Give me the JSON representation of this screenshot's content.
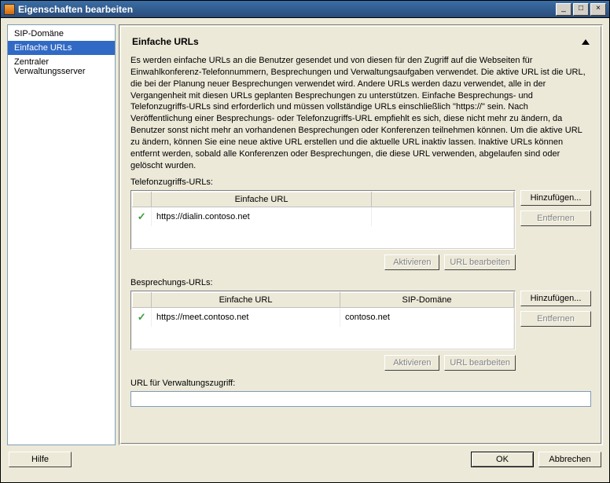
{
  "window": {
    "title": "Eigenschaften bearbeiten"
  },
  "sidebar": {
    "items": [
      {
        "label": "SIP-Domäne"
      },
      {
        "label": "Einfache URLs"
      },
      {
        "label": "Zentraler Verwaltungsserver"
      }
    ],
    "selectedIndex": 1
  },
  "panel": {
    "title": "Einfache URLs",
    "description": "Es werden einfache URLs an die Benutzer gesendet und von diesen für den Zugriff auf die Webseiten für Einwahlkonferenz-Telefonnummern, Besprechungen und Verwaltungsaufgaben verwendet. Die aktive URL ist die URL, die bei der Planung neuer Besprechungen verwendet wird. Andere URLs werden dazu verwendet, alle in der Vergangenheit mit diesen URLs geplanten Besprechungen zu unterstützen. Einfache Besprechungs- und Telefonzugriffs-URLs sind erforderlich und müssen vollständige URLs einschließlich \"https://\" sein. Nach Veröffentlichung einer Besprechungs- oder Telefonzugriffs-URL empfiehlt es sich, diese nicht mehr zu ändern, da Benutzer sonst nicht mehr an vorhandenen Besprechungen oder Konferenzen teilnehmen können. Um die aktive URL zu ändern, können Sie eine neue aktive URL erstellen und die aktuelle URL inaktiv lassen. Inaktive URLs können entfernt werden, sobald alle Konferenzen oder Besprechungen, die diese URL verwenden, abgelaufen sind oder gelöscht wurden."
  },
  "phone": {
    "label": "Telefonzugriffs-URLs:",
    "col_url": "Einfache URL",
    "rows": [
      {
        "url": "https://dialin.contoso.net"
      }
    ]
  },
  "meeting": {
    "label": "Besprechungs-URLs:",
    "col_url": "Einfache URL",
    "col_sip": "SIP-Domäne",
    "rows": [
      {
        "url": "https://meet.contoso.net",
        "sip": "contoso.net"
      }
    ]
  },
  "admin": {
    "label": "URL für Verwaltungszugriff:",
    "value": ""
  },
  "buttons": {
    "add": "Hinzufügen...",
    "remove": "Entfernen",
    "activate": "Aktivieren",
    "edit": "URL bearbeiten",
    "help": "Hilfe",
    "ok": "OK",
    "cancel": "Abbrechen"
  }
}
